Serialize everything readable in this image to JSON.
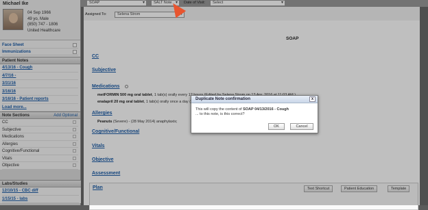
{
  "patient": {
    "name": "Michael Ike",
    "dob": "04 Sep 1966",
    "age_sex": "49 yo, Male",
    "phone": "(850) 747 - 1806",
    "insurance": "United Healthcare"
  },
  "sidebar": {
    "links": [
      "Face Sheet",
      "Immunizations"
    ],
    "patient_notes_header": "Patient Notes",
    "notes": [
      "4/13/16 - Cough",
      "4/7/16 -",
      "3/31/16",
      "3/16/16",
      "3/16/16 - Patient reports",
      "Load more..."
    ],
    "note_sections_header": "Note Sections",
    "add_optional": "Add Optional",
    "sections": [
      "CC",
      "Subjective",
      "Medications",
      "Allergies",
      "Cognitive/Functional",
      "Vitals",
      "Objective"
    ],
    "labs_header": "Labs/Studies",
    "labs": [
      "12/10/15 - CBC diff",
      "1/15/15 - labs"
    ]
  },
  "toolbar": {
    "note_type": "SOAP",
    "salt_note": "SALT Note",
    "date_label": "Date of Visit:",
    "date_value": "Select"
  },
  "assigned": {
    "label": "Assigned To:",
    "value": "Selena Strom"
  },
  "document": {
    "title": "SOAP",
    "headings": {
      "cc": "CC",
      "subjective": "Subjective",
      "medications": "Medications",
      "allergies": "Allergies",
      "cognitive": "Cognitive/Functional",
      "vitals": "Vitals",
      "objective": "Objective",
      "assessment": "Assessment",
      "plan": "Plan"
    },
    "med1_name": "metFORMIN 500 mg oral tablet",
    "med1_detail": ", 1 tab(s) orally every 12 hours (Edited by Selena Strom on 13 Apr, 2016 at 11:03 AM )",
    "med2_name": "enalapril 20 mg oral tablet",
    "med2_detail": ", 1 tab(s) orally once a day (Edited by Selena Strom on 13 Apr, 2016 at 11:03 AM)",
    "allergy_name": "Peanuts",
    "allergy_detail": " (Severe) - (28 May 2014) anaphylaxis;",
    "buttons": [
      "Text Shortcut",
      "Patient Education",
      "Template"
    ]
  },
  "dialog": {
    "title": "Duplicate Note confirmation",
    "text_prefix": "This will copy the content of ",
    "text_bold": "SOAP 04/13/2016 - Cough",
    "text_suffix": "... to this note, is this correct?",
    "ok": "OK",
    "cancel": "Cancel",
    "close": "x"
  }
}
